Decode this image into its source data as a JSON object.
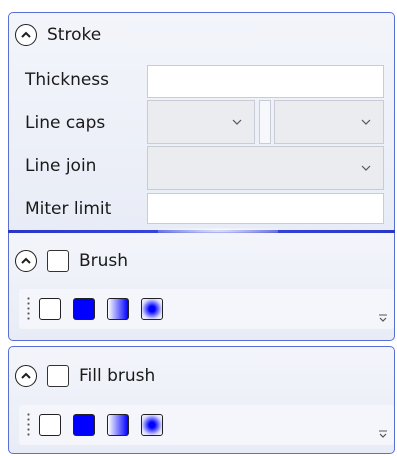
{
  "stroke": {
    "header_label": "Stroke",
    "thickness_label": "Thickness",
    "thickness_value": "",
    "line_caps_label": "Line caps",
    "line_caps_start_value": "",
    "line_caps_end_value": "",
    "line_join_label": "Line join",
    "line_join_value": "",
    "miter_limit_label": "Miter limit",
    "miter_limit_value": ""
  },
  "brush": {
    "header_label": "Brush",
    "enabled": false,
    "swatches": [
      "no-brush",
      "solid-brush",
      "linear-gradient-brush",
      "radial-gradient-brush"
    ]
  },
  "fill_brush": {
    "header_label": "Fill brush",
    "enabled": false,
    "swatches": [
      "no-brush",
      "solid-brush",
      "linear-gradient-brush",
      "radial-gradient-brush"
    ]
  },
  "colors": {
    "accent": "#2a36c8",
    "solid_brush": "#0000ff",
    "panel_border": "#5a6fd6"
  },
  "icons": {
    "collapse": "chevron-up-icon",
    "dropdown": "chevron-down-icon",
    "grip": "grip-icon",
    "overflow": "overflow-icon"
  }
}
